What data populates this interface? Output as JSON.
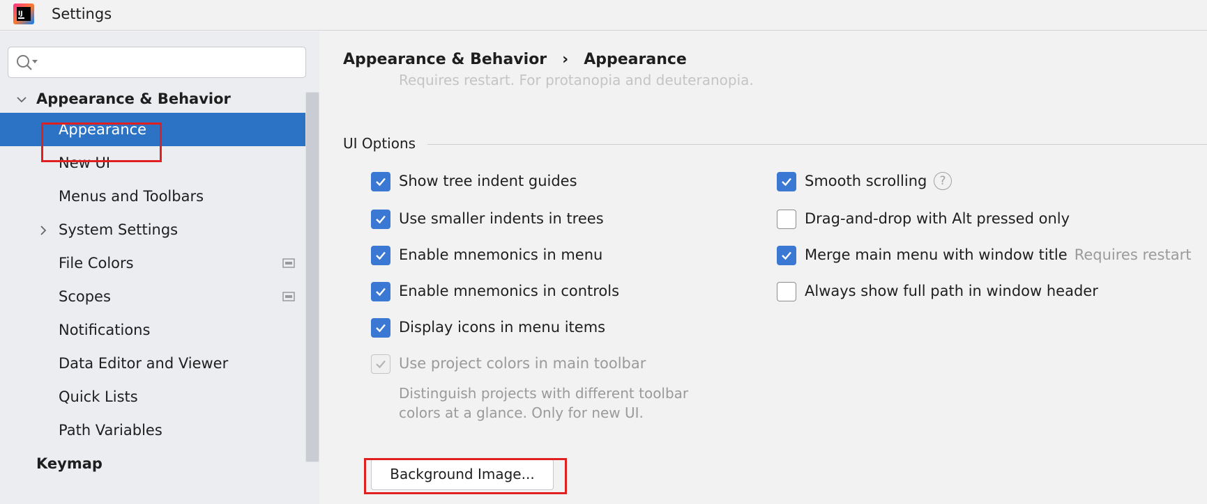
{
  "window": {
    "title": "Settings"
  },
  "search": {
    "placeholder": "",
    "value": ""
  },
  "sidebar": {
    "items": [
      {
        "label": "Appearance & Behavior",
        "level": 0,
        "expanded": true,
        "bold": true
      },
      {
        "label": "Appearance",
        "level": 1,
        "selected": true
      },
      {
        "label": "New UI",
        "level": 1
      },
      {
        "label": "Menus and Toolbars",
        "level": 1
      },
      {
        "label": "System Settings",
        "level": 1,
        "collapsed": true
      },
      {
        "label": "File Colors",
        "level": 1,
        "project_icon": true
      },
      {
        "label": "Scopes",
        "level": 1,
        "project_icon": true
      },
      {
        "label": "Notifications",
        "level": 1
      },
      {
        "label": "Data Editor and Viewer",
        "level": 1
      },
      {
        "label": "Quick Lists",
        "level": 1
      },
      {
        "label": "Path Variables",
        "level": 1
      },
      {
        "label": "Keymap",
        "level": 0,
        "bold": true
      }
    ]
  },
  "breadcrumb": {
    "parent": "Appearance & Behavior",
    "separator": "›",
    "current": "Appearance"
  },
  "faded_text": "Requires restart. For protanopia and deuteranopia.",
  "ui_options": {
    "title": "UI Options",
    "left": [
      {
        "label": "Show tree indent guides",
        "checked": true
      },
      {
        "label": "Use smaller indents in trees",
        "checked": true
      },
      {
        "label": "Enable mnemonics in menu",
        "checked": true
      },
      {
        "label": "Enable mnemonics in controls",
        "checked": true
      },
      {
        "label": "Display icons in menu items",
        "checked": true
      },
      {
        "label": "Use project colors in main toolbar",
        "checked": true,
        "disabled": true
      }
    ],
    "right": [
      {
        "label": "Smooth scrolling",
        "checked": true,
        "help": "?"
      },
      {
        "label": "Drag-and-drop with Alt pressed only",
        "checked": false
      },
      {
        "label": "Merge main menu with window title",
        "checked": true,
        "hint": "Requires restart"
      },
      {
        "label": "Always show full path in window header",
        "checked": false
      }
    ],
    "project_colors_desc": "Distinguish projects with different toolbar colors at a glance. Only for new UI."
  },
  "background_image_button": "Background Image...",
  "colors": {
    "selection": "#2d73c5",
    "checkbox": "#3a78d4",
    "highlight": "#e02020"
  }
}
